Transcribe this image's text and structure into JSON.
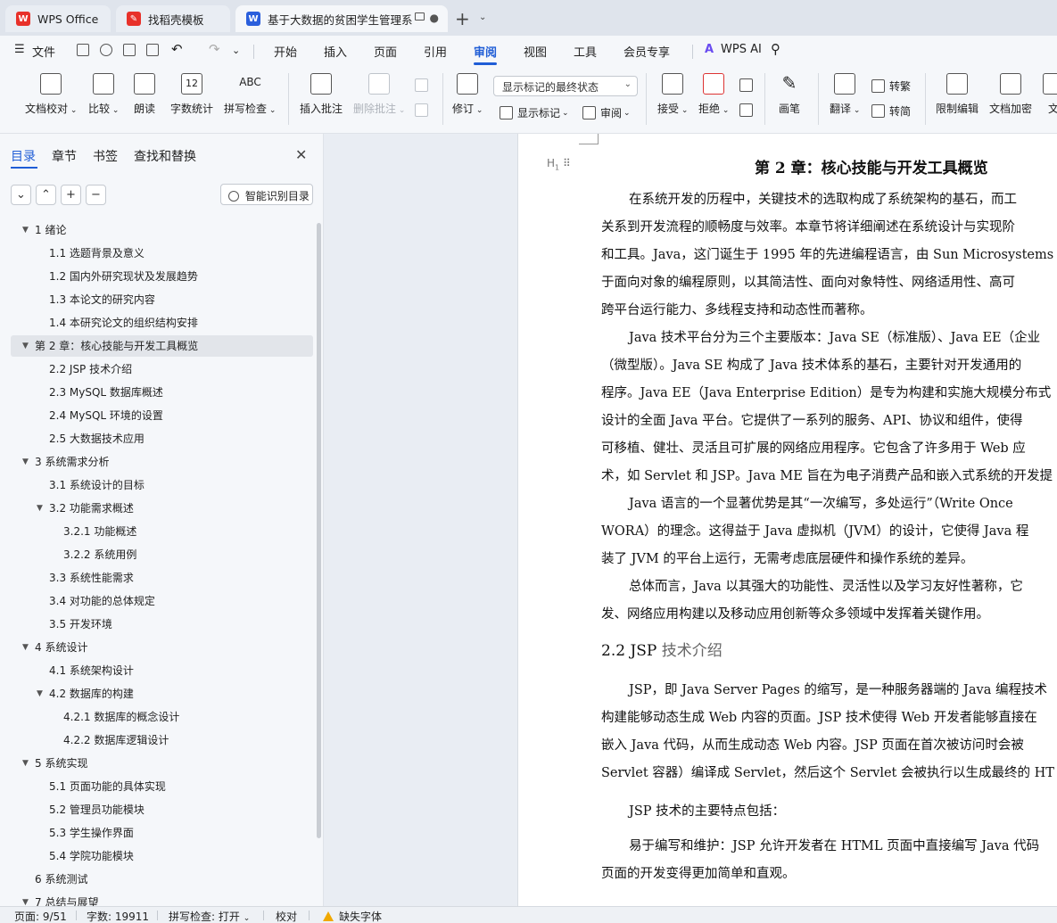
{
  "tabs": [
    {
      "label": "WPS Office",
      "icon": "wps-logo-icon",
      "color": "#e8312a"
    },
    {
      "label": "找稻壳模板",
      "icon": "docer-icon",
      "color": "#e8312a"
    },
    {
      "label": "基于大数据的贫困学生管理系",
      "icon": "word-doc-icon",
      "color": "#2b5fdc"
    }
  ],
  "menu": {
    "file_label": "文件",
    "items": [
      "开始",
      "插入",
      "页面",
      "引用",
      "审阅",
      "视图",
      "工具",
      "会员专享"
    ],
    "active": "审阅",
    "ai_label": "WPS AI"
  },
  "ribbon": {
    "doc_check": "文档校对",
    "compare": "比较",
    "read_aloud": "朗读",
    "word_count": "字数统计",
    "spell_check": "拼写检查",
    "insert_comment": "插入批注",
    "delete_comment": "删除批注",
    "revise": "修订",
    "markup_select": "显示标记的最终状态",
    "show_markup": "显示标记",
    "review": "审阅",
    "accept": "接受",
    "reject": "拒绝",
    "pen": "画笔",
    "translate": "翻译",
    "to_traditional": "转繁",
    "to_simplified": "转简",
    "restrict_edit": "限制编辑",
    "encrypt": "文档加密",
    "doc_cut": "文",
    "spell_icon_text": "ABC",
    "wordcount_icon_text": "12"
  },
  "nav": {
    "tabs": [
      "目录",
      "章节",
      "书签",
      "查找和替换"
    ],
    "smart_toc": "智能识别目录",
    "buttons": [
      "⌄",
      "⌃",
      "+",
      "−"
    ],
    "toc": [
      {
        "text": "1  绪论",
        "level": 1,
        "expanded": true
      },
      {
        "text": "1.1 选题背景及意义",
        "level": 2
      },
      {
        "text": "1.2  国内外研究现状及发展趋势",
        "level": 2
      },
      {
        "text": "1.3 本论文的研究内容",
        "level": 2
      },
      {
        "text": "1.4 本研究论文的组织结构安排",
        "level": 2
      },
      {
        "text": "第 2 章：核心技能与开发工具概览",
        "level": 1,
        "expanded": true,
        "selected": true
      },
      {
        "text": "2.2 JSP 技术介绍",
        "level": 2
      },
      {
        "text": "2.3 MySQL  数据库概述",
        "level": 2
      },
      {
        "text": "2.4 MySQL 环境的设置",
        "level": 2
      },
      {
        "text": "2.5 大数据技术应用",
        "level": 2
      },
      {
        "text": "3 系统需求分析",
        "level": 1,
        "expanded": true
      },
      {
        "text": "3.1 系统设计的目标",
        "level": 2
      },
      {
        "text": "3.2  功能需求概述",
        "level": 2,
        "expanded": true
      },
      {
        "text": "3.2.1  功能概述",
        "level": 3
      },
      {
        "text": "3.2.2   系统用例",
        "level": 3
      },
      {
        "text": "3.3 系统性能需求",
        "level": 2
      },
      {
        "text": "3.4 对功能的总体规定",
        "level": 2
      },
      {
        "text": "3.5  开发环境",
        "level": 2
      },
      {
        "text": "4 系统设计",
        "level": 1,
        "expanded": true
      },
      {
        "text": "4.1  系统架构设计",
        "level": 2
      },
      {
        "text": "4.2  数据库的构建",
        "level": 2,
        "expanded": true
      },
      {
        "text": "4.2.1  数据库的概念设计",
        "level": 3
      },
      {
        "text": "4.2.2  数据库逻辑设计",
        "level": 3
      },
      {
        "text": "5 系统实现",
        "level": 1,
        "expanded": true
      },
      {
        "text": "5.1  页面功能的具体实现",
        "level": 2
      },
      {
        "text": "5.2 管理员功能模块",
        "level": 2
      },
      {
        "text": "5.3  学生操作界面",
        "level": 2
      },
      {
        "text": "5.4  学院功能模块",
        "level": 2
      },
      {
        "text": "6 系统测试",
        "level": 1
      },
      {
        "text": "7 总结与展望",
        "level": 1,
        "expanded": true
      }
    ]
  },
  "document": {
    "heading_marker": "H",
    "chapter_title": "第 2 章：核心技能与开发工具概览",
    "lines": [
      {
        "text": "在系统开发的历程中，关键技术的选取构成了系统架构的基石，而工",
        "indent": true
      },
      {
        "text": "关系到开发流程的顺畅度与效率。本章节将详细阐述在系统设计与实现阶",
        "indent": false
      },
      {
        "text": "和工具。Java，这门诞生于 1995 年的先进编程语言，由 Sun Microsystems",
        "indent": false
      },
      {
        "text": "于面向对象的编程原则，以其简洁性、面向对象特性、网络适用性、高可",
        "indent": false
      },
      {
        "text": "跨平台运行能力、多线程支持和动态性而著称。",
        "indent": false
      },
      {
        "text": "Java 技术平台分为三个主要版本：Java SE（标准版）、Java EE（企业",
        "indent": true
      },
      {
        "text": "（微型版）。Java SE 构成了 Java 技术体系的基石，主要针对开发通用的",
        "indent": false
      },
      {
        "text": "程序。Java EE（Java Enterprise Edition）是专为构建和实施大规模分布式",
        "indent": false
      },
      {
        "text": "设计的全面 Java 平台。它提供了一系列的服务、API、协议和组件，使得",
        "indent": false
      },
      {
        "text": "可移植、健壮、灵活且可扩展的网络应用程序。它包含了许多用于 Web 应",
        "indent": false
      },
      {
        "text": "术，如 Servlet 和 JSP。Java ME 旨在为电子消费产品和嵌入式系统的开发提",
        "indent": false
      },
      {
        "text": "Java 语言的一个显著优势是其“一次编写，多处运行”（Write Once",
        "indent": true
      },
      {
        "text": "WORA）的理念。这得益于 Java 虚拟机（JVM）的设计，它使得 Java 程",
        "indent": false
      },
      {
        "text": "装了 JVM 的平台上运行，无需考虑底层硬件和操作系统的差异。",
        "indent": false
      },
      {
        "text": "总体而言，Java 以其强大的功能性、灵活性以及学习友好性著称，它",
        "indent": true
      },
      {
        "text": "发、网络应用构建以及移动应用创新等众多领域中发挥着关键作用。",
        "indent": false
      }
    ],
    "section_num": "2.2 JSP",
    "section_title": " 技术介绍",
    "lines2": [
      {
        "text": "JSP，即 Java Server Pages 的缩写，是一种服务器端的 Java 编程技术",
        "indent": true
      },
      {
        "text": "构建能够动态生成 Web 内容的页面。JSP 技术使得 Web 开发者能够直接在",
        "indent": false
      },
      {
        "text": "嵌入 Java 代码，从而生成动态 Web 内容。JSP 页面在首次被访问时会被",
        "indent": false
      },
      {
        "text": "Servlet 容器）编译成 Servlet，然后这个 Servlet 会被执行以生成最终的 HT",
        "indent": false
      },
      {
        "text": "JSP 技术的主要特点包括：",
        "indent": true
      },
      {
        "text": "易于编写和维护：JSP 允许开发者在 HTML 页面中直接编写 Java 代码",
        "indent": true
      },
      {
        "text": "页面的开发变得更加简单和直观。",
        "indent": false
      }
    ]
  },
  "status": {
    "page": "页面: 9/51",
    "words": "字数: 19911",
    "spell": "拼写检查: 打开",
    "proof": "校对",
    "missing_font": "缺失字体"
  }
}
